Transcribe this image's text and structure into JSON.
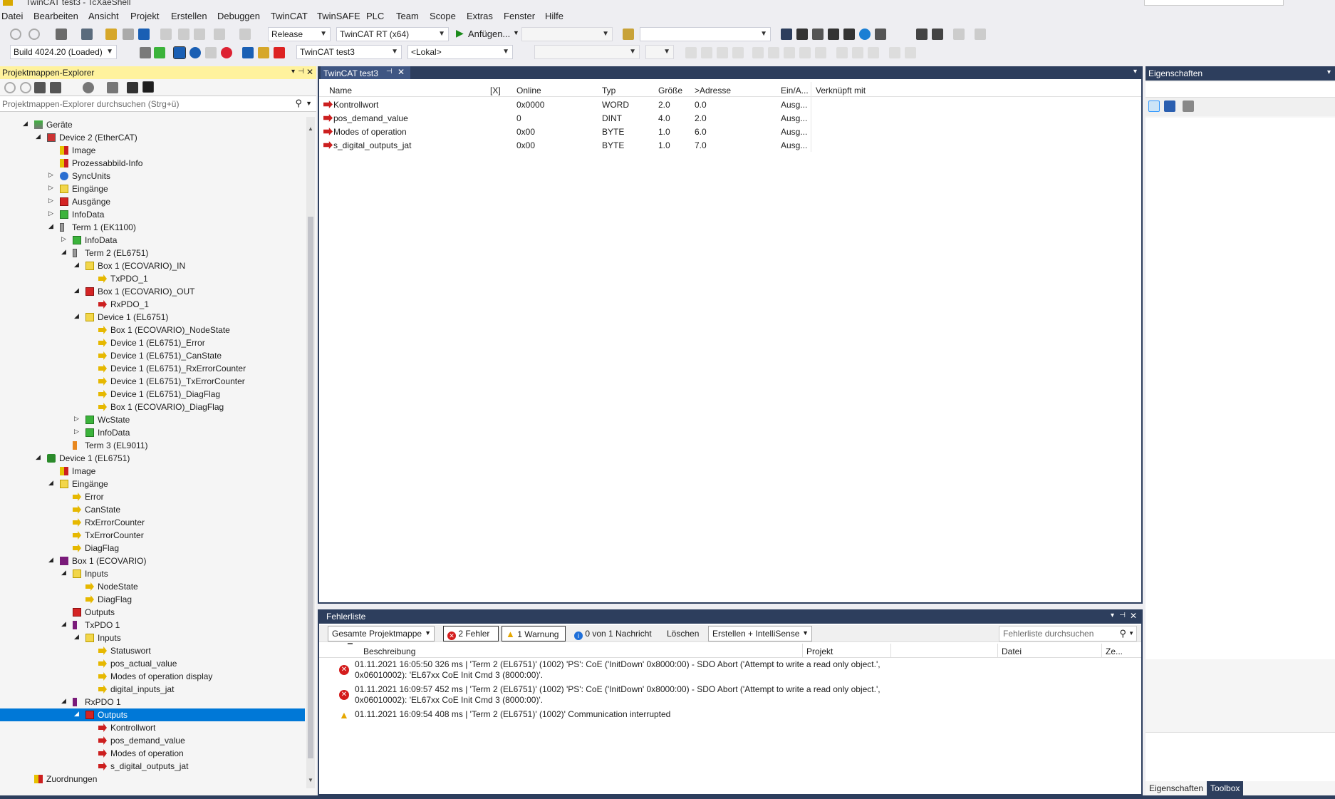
{
  "window": {
    "title": "TwinCAT test3 - TcXaeShell"
  },
  "menu": [
    "Datei",
    "Bearbeiten",
    "Ansicht",
    "Projekt",
    "Erstellen",
    "Debuggen",
    "TwinCAT",
    "TwinSAFE",
    "PLC",
    "Team",
    "Scope",
    "Extras",
    "Fenster",
    "Hilfe"
  ],
  "toolbar1": {
    "config": "Release",
    "platform": "TwinCAT RT (x64)",
    "attach": "Anfügen..."
  },
  "toolbar2": {
    "build": "Build 4024.20 (Loaded)",
    "project": "TwinCAT test3",
    "target": "<Lokal>"
  },
  "explorer": {
    "title": "Projektmappen-Explorer",
    "search_placeholder": "Projektmappen-Explorer durchsuchen (Strg+ü)",
    "rows": [
      {
        "label": "Geräte",
        "level": 0,
        "exp": "open",
        "icon": "devices-icon"
      },
      {
        "label": "Device 2 (EtherCAT)",
        "level": 1,
        "exp": "open",
        "icon": "ethercat-device-icon"
      },
      {
        "label": "Image",
        "level": 2,
        "exp": "",
        "icon": "image-icon"
      },
      {
        "label": "Prozessabbild-Info",
        "level": 2,
        "exp": "",
        "icon": "image-icon"
      },
      {
        "label": "SyncUnits",
        "level": 2,
        "exp": "closed",
        "icon": "sync-icon"
      },
      {
        "label": "Eingänge",
        "level": 2,
        "exp": "closed",
        "icon": "inputs-folder-icon"
      },
      {
        "label": "Ausgänge",
        "level": 2,
        "exp": "closed",
        "icon": "outputs-folder-icon"
      },
      {
        "label": "InfoData",
        "level": 2,
        "exp": "closed",
        "icon": "infodata-icon"
      },
      {
        "label": "Term 1 (EK1100)",
        "level": 2,
        "exp": "open",
        "icon": "terminal-icon"
      },
      {
        "label": "InfoData",
        "level": 3,
        "exp": "closed",
        "icon": "infodata-icon"
      },
      {
        "label": "Term 2 (EL6751)",
        "level": 3,
        "exp": "open",
        "icon": "terminal-icon"
      },
      {
        "label": "Box 1 (ECOVARIO)_IN",
        "level": 4,
        "exp": "open",
        "icon": "inputs-folder-icon"
      },
      {
        "label": "TxPDO_1",
        "level": 5,
        "exp": "",
        "icon": "input-var-icon"
      },
      {
        "label": "Box 1 (ECOVARIO)_OUT",
        "level": 4,
        "exp": "open",
        "icon": "outputs-folder-icon"
      },
      {
        "label": "RxPDO_1",
        "level": 5,
        "exp": "",
        "icon": "output-var-icon"
      },
      {
        "label": "Device 1 (EL6751)",
        "level": 4,
        "exp": "open",
        "icon": "inputs-folder-icon"
      },
      {
        "label": "Box 1 (ECOVARIO)_NodeState",
        "level": 5,
        "exp": "",
        "icon": "input-var-icon"
      },
      {
        "label": "Device 1 (EL6751)_Error",
        "level": 5,
        "exp": "",
        "icon": "input-var-icon"
      },
      {
        "label": "Device 1 (EL6751)_CanState",
        "level": 5,
        "exp": "",
        "icon": "input-var-icon"
      },
      {
        "label": "Device 1 (EL6751)_RxErrorCounter",
        "level": 5,
        "exp": "",
        "icon": "input-var-icon"
      },
      {
        "label": "Device 1 (EL6751)_TxErrorCounter",
        "level": 5,
        "exp": "",
        "icon": "input-var-icon"
      },
      {
        "label": "Device 1 (EL6751)_DiagFlag",
        "level": 5,
        "exp": "",
        "icon": "input-var-icon"
      },
      {
        "label": "Box 1 (ECOVARIO)_DiagFlag",
        "level": 5,
        "exp": "",
        "icon": "input-var-icon"
      },
      {
        "label": "WcState",
        "level": 4,
        "exp": "closed",
        "icon": "infodata-icon"
      },
      {
        "label": "InfoData",
        "level": 4,
        "exp": "closed",
        "icon": "infodata-icon"
      },
      {
        "label": "Term 3 (EL9011)",
        "level": 3,
        "exp": "",
        "icon": "terminal-end-icon"
      },
      {
        "label": "Device 1 (EL6751)",
        "level": 1,
        "exp": "open",
        "icon": "can-device-icon"
      },
      {
        "label": "Image",
        "level": 2,
        "exp": "",
        "icon": "image-icon"
      },
      {
        "label": "Eingänge",
        "level": 2,
        "exp": "open",
        "icon": "inputs-folder-icon"
      },
      {
        "label": "Error",
        "level": 3,
        "exp": "",
        "icon": "input-var-icon"
      },
      {
        "label": "CanState",
        "level": 3,
        "exp": "",
        "icon": "input-var-icon"
      },
      {
        "label": "RxErrorCounter",
        "level": 3,
        "exp": "",
        "icon": "input-var-icon"
      },
      {
        "label": "TxErrorCounter",
        "level": 3,
        "exp": "",
        "icon": "input-var-icon"
      },
      {
        "label": "DiagFlag",
        "level": 3,
        "exp": "",
        "icon": "input-var-icon"
      },
      {
        "label": "Box 1 (ECOVARIO)",
        "level": 2,
        "exp": "open",
        "icon": "box-icon"
      },
      {
        "label": "Inputs",
        "level": 3,
        "exp": "open",
        "icon": "inputs-folder-icon"
      },
      {
        "label": "NodeState",
        "level": 4,
        "exp": "",
        "icon": "input-var-icon"
      },
      {
        "label": "DiagFlag",
        "level": 4,
        "exp": "",
        "icon": "input-var-icon"
      },
      {
        "label": "Outputs",
        "level": 3,
        "exp": "",
        "icon": "outputs-folder-icon"
      },
      {
        "label": "TxPDO 1",
        "level": 3,
        "exp": "open",
        "icon": "txpdo-icon"
      },
      {
        "label": "Inputs",
        "level": 4,
        "exp": "open",
        "icon": "inputs-folder-icon"
      },
      {
        "label": "Statuswort",
        "level": 5,
        "exp": "",
        "icon": "input-var-icon"
      },
      {
        "label": "pos_actual_value",
        "level": 5,
        "exp": "",
        "icon": "input-var-icon"
      },
      {
        "label": "Modes of operation display",
        "level": 5,
        "exp": "",
        "icon": "input-var-icon"
      },
      {
        "label": "digital_inputs_jat",
        "level": 5,
        "exp": "",
        "icon": "input-var-icon"
      },
      {
        "label": "RxPDO 1",
        "level": 3,
        "exp": "open",
        "icon": "rxpdo-icon"
      },
      {
        "label": "Outputs",
        "level": 4,
        "exp": "open",
        "icon": "outputs-folder-icon",
        "selected": true
      },
      {
        "label": "Kontrollwort",
        "level": 5,
        "exp": "",
        "icon": "output-var-icon"
      },
      {
        "label": "pos_demand_value",
        "level": 5,
        "exp": "",
        "icon": "output-var-icon"
      },
      {
        "label": "Modes of operation",
        "level": 5,
        "exp": "",
        "icon": "output-var-icon"
      },
      {
        "label": "s_digital_outputs_jat",
        "level": 5,
        "exp": "",
        "icon": "output-var-icon"
      },
      {
        "label": "Zuordnungen",
        "level": 0,
        "exp": "",
        "icon": "mappings-icon"
      }
    ]
  },
  "doc_tab": {
    "label": "TwinCAT test3"
  },
  "var_table": {
    "headers": {
      "name": "Name",
      "x": "[X]",
      "online": "Online",
      "type": "Typ",
      "size": "Größe",
      "addr": ">Adresse",
      "io": "Ein/A...",
      "linked": "Verknüpft mit"
    },
    "rows": [
      {
        "name": "Kontrollwort",
        "online": "0x0000",
        "type": "WORD",
        "size": "2.0",
        "addr": "0.0",
        "io": "Ausg..."
      },
      {
        "name": "pos_demand_value",
        "online": "0",
        "type": "DINT",
        "size": "4.0",
        "addr": "2.0",
        "io": "Ausg..."
      },
      {
        "name": "Modes of operation",
        "online": "0x00",
        "type": "BYTE",
        "size": "1.0",
        "addr": "6.0",
        "io": "Ausg..."
      },
      {
        "name": "s_digital_outputs_jat",
        "online": "0x00",
        "type": "BYTE",
        "size": "1.0",
        "addr": "7.0",
        "io": "Ausg..."
      }
    ]
  },
  "error_list": {
    "title": "Fehlerliste",
    "scope": "Gesamte Projektmappe",
    "errors_btn": "2 Fehler",
    "warnings_btn": "1 Warnung",
    "messages_btn": "0 von 1 Nachricht",
    "clear_btn": "Löschen",
    "filter": "Erstellen + IntelliSense",
    "search_placeholder": "Fehlerliste durchsuchen",
    "headers": {
      "desc": "Beschreibung",
      "project": "Projekt",
      "file": "Datei",
      "line": "Ze..."
    },
    "rows": [
      {
        "kind": "error",
        "line1": "01.11.2021 16:05:50 326 ms | 'Term 2 (EL6751)' (1002) 'PS': CoE ('InitDown' 0x8000:00) - SDO Abort ('Attempt to write a read only object.',",
        "line2": "0x06010002): 'EL67xx CoE Init Cmd 3 (8000:00)'."
      },
      {
        "kind": "error",
        "line1": "01.11.2021 16:09:57 452 ms | 'Term 2 (EL6751)' (1002) 'PS': CoE ('InitDown' 0x8000:00) - SDO Abort ('Attempt to write a read only object.',",
        "line2": "0x06010002): 'EL67xx CoE Init Cmd 3 (8000:00)'."
      },
      {
        "kind": "warning",
        "line1": "01.11.2021 16:09:54 408 ms | 'Term 2 (EL6751)' (1002)' Communication interrupted",
        "line2": ""
      }
    ]
  },
  "properties": {
    "title": "Eigenschaften",
    "tab_props": "Eigenschaften",
    "tab_toolbox": "Toolbox"
  },
  "colors": {
    "accent": "#0078d7",
    "header_dark": "#2d3e5d",
    "input": "#e6c200",
    "output": "#cc1f1f",
    "infodata": "#3bb33b"
  }
}
